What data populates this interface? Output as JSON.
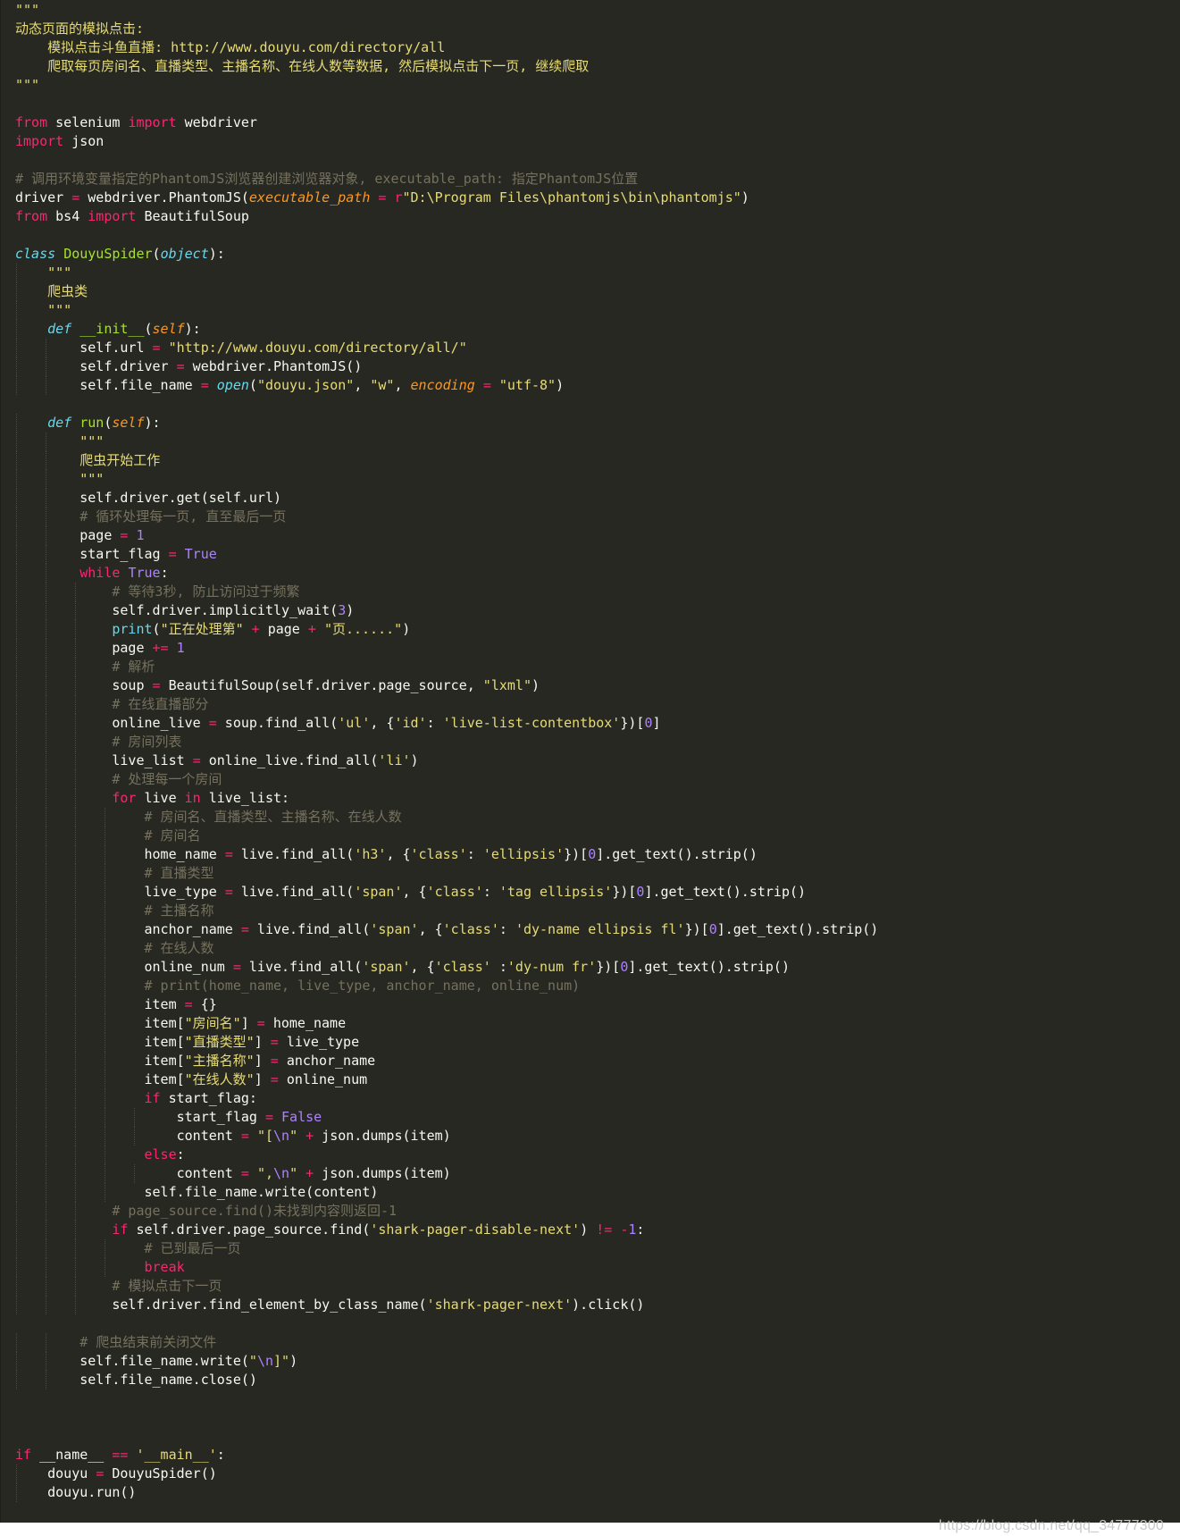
{
  "editor": {
    "language": "python",
    "theme": "monokai",
    "colors": {
      "background": "#272822",
      "text": "#f8f8f2",
      "string": "#e6db74",
      "keyword": "#f92672",
      "builtin": "#66d9ef",
      "number": "#ae81ff",
      "comment": "#75715e",
      "parameter": "#fd971f"
    },
    "lines": [
      [
        [
          "str",
          "\"\"\""
        ]
      ],
      [
        [
          "str",
          "动态页面的模拟点击:"
        ]
      ],
      [
        [
          "str",
          "    模拟点击斗鱼直播: http://www.douyu.com/directory/all"
        ]
      ],
      [
        [
          "str",
          "    爬取每页房间名、直播类型、主播名称、在线人数等数据, 然后模拟点击下一页, 继续爬取"
        ]
      ],
      [
        [
          "str",
          "\"\"\""
        ]
      ],
      [],
      [
        [
          "kw",
          "from"
        ],
        [
          "txt",
          " selenium "
        ],
        [
          "kw",
          "import"
        ],
        [
          "txt",
          " webdriver"
        ]
      ],
      [
        [
          "kw",
          "import"
        ],
        [
          "txt",
          " json"
        ]
      ],
      [],
      [
        [
          "cmt",
          "# 调用环境变量指定的PhantomJS浏览器创建浏览器对象, executable_path: 指定PhantomJS位置"
        ]
      ],
      [
        [
          "txt",
          "driver "
        ],
        [
          "op",
          "="
        ],
        [
          "txt",
          " webdriver.PhantomJS("
        ],
        [
          "par",
          "executable_path"
        ],
        [
          "txt",
          " "
        ],
        [
          "op",
          "="
        ],
        [
          "txt",
          " "
        ],
        [
          "kw",
          "r"
        ],
        [
          "str",
          "\"D:\\Program Files\\phantomjs\\bin\\phantomjs\""
        ],
        [
          "txt",
          ")"
        ]
      ],
      [
        [
          "kw",
          "from"
        ],
        [
          "txt",
          " bs4 "
        ],
        [
          "kw",
          "import"
        ],
        [
          "txt",
          " BeautifulSoup"
        ]
      ],
      [],
      [
        [
          "def",
          "class"
        ],
        [
          "txt",
          " "
        ],
        [
          "cls",
          "DouyuSpider"
        ],
        [
          "txt",
          "("
        ],
        [
          "def",
          "object"
        ],
        [
          "txt",
          "):"
        ]
      ],
      [
        [
          "txt",
          "    "
        ],
        [
          "str",
          "\"\"\""
        ]
      ],
      [
        [
          "txt",
          "    "
        ],
        [
          "str",
          "爬虫类"
        ]
      ],
      [
        [
          "txt",
          "    "
        ],
        [
          "str",
          "\"\"\""
        ]
      ],
      [
        [
          "txt",
          "    "
        ],
        [
          "def",
          "def"
        ],
        [
          "txt",
          " "
        ],
        [
          "fn",
          "__init__"
        ],
        [
          "txt",
          "("
        ],
        [
          "par",
          "self"
        ],
        [
          "txt",
          "):"
        ]
      ],
      [
        [
          "txt",
          "        self.url "
        ],
        [
          "op",
          "="
        ],
        [
          "txt",
          " "
        ],
        [
          "str",
          "\"http://www.douyu.com/directory/all/\""
        ]
      ],
      [
        [
          "txt",
          "        self.driver "
        ],
        [
          "op",
          "="
        ],
        [
          "txt",
          " webdriver.PhantomJS()"
        ]
      ],
      [
        [
          "txt",
          "        self.file_name "
        ],
        [
          "op",
          "="
        ],
        [
          "txt",
          " "
        ],
        [
          "def",
          "open"
        ],
        [
          "txt",
          "("
        ],
        [
          "str",
          "\"douyu.json\""
        ],
        [
          "txt",
          ", "
        ],
        [
          "str",
          "\"w\""
        ],
        [
          "txt",
          ", "
        ],
        [
          "par",
          "encoding"
        ],
        [
          "txt",
          " "
        ],
        [
          "op",
          "="
        ],
        [
          "txt",
          " "
        ],
        [
          "str",
          "\"utf-8\""
        ],
        [
          "txt",
          ")"
        ]
      ],
      [],
      [
        [
          "txt",
          "    "
        ],
        [
          "def",
          "def"
        ],
        [
          "txt",
          " "
        ],
        [
          "fn",
          "run"
        ],
        [
          "txt",
          "("
        ],
        [
          "par",
          "self"
        ],
        [
          "txt",
          "):"
        ]
      ],
      [
        [
          "txt",
          "        "
        ],
        [
          "str",
          "\"\"\""
        ]
      ],
      [
        [
          "txt",
          "        "
        ],
        [
          "str",
          "爬虫开始工作"
        ]
      ],
      [
        [
          "txt",
          "        "
        ],
        [
          "str",
          "\"\"\""
        ]
      ],
      [
        [
          "txt",
          "        self.driver.get(self.url)"
        ]
      ],
      [
        [
          "txt",
          "        "
        ],
        [
          "cmt",
          "# 循环处理每一页, 直至最后一页"
        ]
      ],
      [
        [
          "txt",
          "        page "
        ],
        [
          "op",
          "="
        ],
        [
          "txt",
          " "
        ],
        [
          "num",
          "1"
        ]
      ],
      [
        [
          "txt",
          "        start_flag "
        ],
        [
          "op",
          "="
        ],
        [
          "txt",
          " "
        ],
        [
          "num",
          "True"
        ]
      ],
      [
        [
          "txt",
          "        "
        ],
        [
          "kw",
          "while"
        ],
        [
          "txt",
          " "
        ],
        [
          "num",
          "True"
        ],
        [
          "txt",
          ":"
        ]
      ],
      [
        [
          "txt",
          "            "
        ],
        [
          "cmt",
          "# 等待3秒, 防止访问过于频繁"
        ]
      ],
      [
        [
          "txt",
          "            self.driver.implicitly_wait("
        ],
        [
          "num",
          "3"
        ],
        [
          "txt",
          ")"
        ]
      ],
      [
        [
          "txt",
          "            "
        ],
        [
          "bi",
          "print"
        ],
        [
          "txt",
          "("
        ],
        [
          "str",
          "\"正在处理第\""
        ],
        [
          "txt",
          " "
        ],
        [
          "op",
          "+"
        ],
        [
          "txt",
          " page "
        ],
        [
          "op",
          "+"
        ],
        [
          "txt",
          " "
        ],
        [
          "str",
          "\"页......\""
        ],
        [
          "txt",
          ")"
        ]
      ],
      [
        [
          "txt",
          "            page "
        ],
        [
          "op",
          "+="
        ],
        [
          "txt",
          " "
        ],
        [
          "num",
          "1"
        ]
      ],
      [
        [
          "txt",
          "            "
        ],
        [
          "cmt",
          "# 解析"
        ]
      ],
      [
        [
          "txt",
          "            soup "
        ],
        [
          "op",
          "="
        ],
        [
          "txt",
          " BeautifulSoup(self.driver.page_source, "
        ],
        [
          "str",
          "\"lxml\""
        ],
        [
          "txt",
          ")"
        ]
      ],
      [
        [
          "txt",
          "            "
        ],
        [
          "cmt",
          "# 在线直播部分"
        ]
      ],
      [
        [
          "txt",
          "            online_live "
        ],
        [
          "op",
          "="
        ],
        [
          "txt",
          " soup.find_all("
        ],
        [
          "str",
          "'ul'"
        ],
        [
          "txt",
          ", {"
        ],
        [
          "str",
          "'id'"
        ],
        [
          "txt",
          ": "
        ],
        [
          "str",
          "'live-list-contentbox'"
        ],
        [
          "txt",
          "})["
        ],
        [
          "num",
          "0"
        ],
        [
          "txt",
          "]"
        ]
      ],
      [
        [
          "txt",
          "            "
        ],
        [
          "cmt",
          "# 房间列表"
        ]
      ],
      [
        [
          "txt",
          "            live_list "
        ],
        [
          "op",
          "="
        ],
        [
          "txt",
          " online_live.find_all("
        ],
        [
          "str",
          "'li'"
        ],
        [
          "txt",
          ")"
        ]
      ],
      [
        [
          "txt",
          "            "
        ],
        [
          "cmt",
          "# 处理每一个房间"
        ]
      ],
      [
        [
          "txt",
          "            "
        ],
        [
          "kw",
          "for"
        ],
        [
          "txt",
          " live "
        ],
        [
          "kw",
          "in"
        ],
        [
          "txt",
          " live_list:"
        ]
      ],
      [
        [
          "txt",
          "                "
        ],
        [
          "cmt",
          "# 房间名、直播类型、主播名称、在线人数"
        ]
      ],
      [
        [
          "txt",
          "                "
        ],
        [
          "cmt",
          "# 房间名"
        ]
      ],
      [
        [
          "txt",
          "                home_name "
        ],
        [
          "op",
          "="
        ],
        [
          "txt",
          " live.find_all("
        ],
        [
          "str",
          "'h3'"
        ],
        [
          "txt",
          ", {"
        ],
        [
          "str",
          "'class'"
        ],
        [
          "txt",
          ": "
        ],
        [
          "str",
          "'ellipsis'"
        ],
        [
          "txt",
          "})["
        ],
        [
          "num",
          "0"
        ],
        [
          "txt",
          "].get_text().strip()"
        ]
      ],
      [
        [
          "txt",
          "                "
        ],
        [
          "cmt",
          "# 直播类型"
        ]
      ],
      [
        [
          "txt",
          "                live_type "
        ],
        [
          "op",
          "="
        ],
        [
          "txt",
          " live.find_all("
        ],
        [
          "str",
          "'span'"
        ],
        [
          "txt",
          ", {"
        ],
        [
          "str",
          "'class'"
        ],
        [
          "txt",
          ": "
        ],
        [
          "str",
          "'tag ellipsis'"
        ],
        [
          "txt",
          "})["
        ],
        [
          "num",
          "0"
        ],
        [
          "txt",
          "].get_text().strip()"
        ]
      ],
      [
        [
          "txt",
          "                "
        ],
        [
          "cmt",
          "# 主播名称"
        ]
      ],
      [
        [
          "txt",
          "                anchor_name "
        ],
        [
          "op",
          "="
        ],
        [
          "txt",
          " live.find_all("
        ],
        [
          "str",
          "'span'"
        ],
        [
          "txt",
          ", {"
        ],
        [
          "str",
          "'class'"
        ],
        [
          "txt",
          ": "
        ],
        [
          "str",
          "'dy-name ellipsis fl'"
        ],
        [
          "txt",
          "})["
        ],
        [
          "num",
          "0"
        ],
        [
          "txt",
          "].get_text().strip()"
        ]
      ],
      [
        [
          "txt",
          "                "
        ],
        [
          "cmt",
          "# 在线人数"
        ]
      ],
      [
        [
          "txt",
          "                online_num "
        ],
        [
          "op",
          "="
        ],
        [
          "txt",
          " live.find_all("
        ],
        [
          "str",
          "'span'"
        ],
        [
          "txt",
          ", {"
        ],
        [
          "str",
          "'class'"
        ],
        [
          "txt",
          " :"
        ],
        [
          "str",
          "'dy-num fr'"
        ],
        [
          "txt",
          "})["
        ],
        [
          "num",
          "0"
        ],
        [
          "txt",
          "].get_text().strip()"
        ]
      ],
      [
        [
          "txt",
          "                "
        ],
        [
          "cmt",
          "# print(home_name, live_type, anchor_name, online_num)"
        ]
      ],
      [
        [
          "txt",
          "                item "
        ],
        [
          "op",
          "="
        ],
        [
          "txt",
          " {}"
        ]
      ],
      [
        [
          "txt",
          "                item["
        ],
        [
          "str",
          "\"房间名\""
        ],
        [
          "txt",
          "] "
        ],
        [
          "op",
          "="
        ],
        [
          "txt",
          " home_name"
        ]
      ],
      [
        [
          "txt",
          "                item["
        ],
        [
          "str",
          "\"直播类型\""
        ],
        [
          "txt",
          "] "
        ],
        [
          "op",
          "="
        ],
        [
          "txt",
          " live_type"
        ]
      ],
      [
        [
          "txt",
          "                item["
        ],
        [
          "str",
          "\"主播名称\""
        ],
        [
          "txt",
          "] "
        ],
        [
          "op",
          "="
        ],
        [
          "txt",
          " anchor_name"
        ]
      ],
      [
        [
          "txt",
          "                item["
        ],
        [
          "str",
          "\"在线人数\""
        ],
        [
          "txt",
          "] "
        ],
        [
          "op",
          "="
        ],
        [
          "txt",
          " online_num"
        ]
      ],
      [
        [
          "txt",
          "                "
        ],
        [
          "kw",
          "if"
        ],
        [
          "txt",
          " start_flag:"
        ]
      ],
      [
        [
          "txt",
          "                    start_flag "
        ],
        [
          "op",
          "="
        ],
        [
          "txt",
          " "
        ],
        [
          "num",
          "False"
        ]
      ],
      [
        [
          "txt",
          "                    content "
        ],
        [
          "op",
          "="
        ],
        [
          "txt",
          " "
        ],
        [
          "str",
          "\"["
        ],
        [
          "num",
          "\\n"
        ],
        [
          "str",
          "\""
        ],
        [
          "txt",
          " "
        ],
        [
          "op",
          "+"
        ],
        [
          "txt",
          " json.dumps(item)"
        ]
      ],
      [
        [
          "txt",
          "                "
        ],
        [
          "kw",
          "else"
        ],
        [
          "txt",
          ":"
        ]
      ],
      [
        [
          "txt",
          "                    content "
        ],
        [
          "op",
          "="
        ],
        [
          "txt",
          " "
        ],
        [
          "str",
          "\","
        ],
        [
          "num",
          "\\n"
        ],
        [
          "str",
          "\""
        ],
        [
          "txt",
          " "
        ],
        [
          "op",
          "+"
        ],
        [
          "txt",
          " json.dumps(item)"
        ]
      ],
      [
        [
          "txt",
          "                self.file_name.write(content)"
        ]
      ],
      [
        [
          "txt",
          "            "
        ],
        [
          "cmt",
          "# page_source.find()未找到内容则返回-1"
        ]
      ],
      [
        [
          "txt",
          "            "
        ],
        [
          "kw",
          "if"
        ],
        [
          "txt",
          " self.driver.page_source.find("
        ],
        [
          "str",
          "'shark-pager-disable-next'"
        ],
        [
          "txt",
          ") "
        ],
        [
          "op",
          "!="
        ],
        [
          "txt",
          " "
        ],
        [
          "op",
          "-"
        ],
        [
          "num",
          "1"
        ],
        [
          "txt",
          ":"
        ]
      ],
      [
        [
          "txt",
          "                "
        ],
        [
          "cmt",
          "# 已到最后一页"
        ]
      ],
      [
        [
          "txt",
          "                "
        ],
        [
          "kw",
          "break"
        ]
      ],
      [
        [
          "txt",
          "            "
        ],
        [
          "cmt",
          "# 模拟点击下一页"
        ]
      ],
      [
        [
          "txt",
          "            self.driver.find_element_by_class_name("
        ],
        [
          "str",
          "'shark-pager-next'"
        ],
        [
          "txt",
          ").click()"
        ]
      ],
      [],
      [
        [
          "txt",
          "        "
        ],
        [
          "cmt",
          "# 爬虫结束前关闭文件"
        ]
      ],
      [
        [
          "txt",
          "        self.file_name.write("
        ],
        [
          "str",
          "\""
        ],
        [
          "num",
          "\\n"
        ],
        [
          "str",
          "]\""
        ],
        [
          "txt",
          ")"
        ]
      ],
      [
        [
          "txt",
          "        self.file_name.close()"
        ]
      ],
      [],
      [],
      [],
      [
        [
          "kw",
          "if"
        ],
        [
          "txt",
          " __name__ "
        ],
        [
          "op",
          "=="
        ],
        [
          "txt",
          " "
        ],
        [
          "str",
          "'__main__'"
        ],
        [
          "txt",
          ":"
        ]
      ],
      [
        [
          "txt",
          "    douyu "
        ],
        [
          "op",
          "="
        ],
        [
          "txt",
          " DouyuSpider()"
        ]
      ],
      [
        [
          "txt",
          "    douyu.run()"
        ]
      ]
    ]
  },
  "watermark": {
    "text": "https://blog.csdn.net/qq_34777300"
  }
}
